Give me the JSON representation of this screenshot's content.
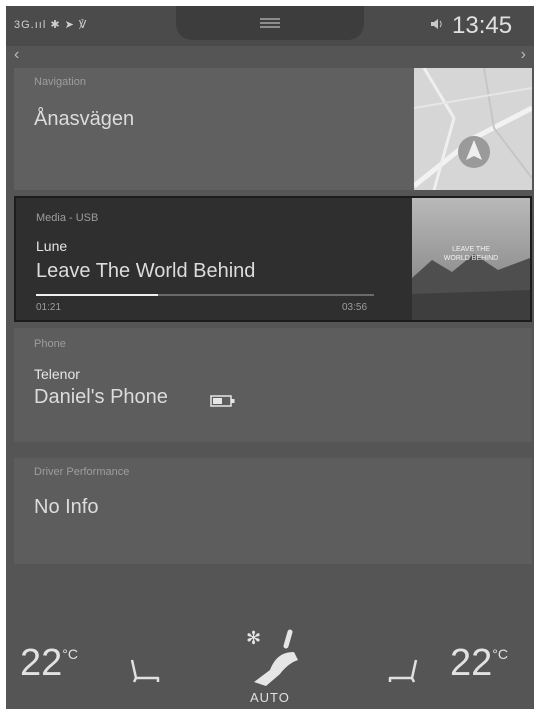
{
  "status_bar": {
    "indicators": "3G.ııl ✱ ➤ ℣",
    "volume_icon": "speaker-icon",
    "time": "13:45"
  },
  "pager": {
    "pages": 3,
    "active": 2
  },
  "navigation": {
    "label": "Navigation",
    "destination": "Ånasvägen"
  },
  "media": {
    "label": "Media - USB",
    "artist": "Lune",
    "track": "Leave The World Behind",
    "elapsed": "01:21",
    "duration": "03:56",
    "progress_fraction": 0.36,
    "album_text_line1": "LEAVE THE",
    "album_text_line2": "WORLD BEHIND"
  },
  "phone": {
    "label": "Phone",
    "carrier": "Telenor",
    "device": "Daniel's Phone"
  },
  "driver_performance": {
    "label": "Driver Performance",
    "value": "No Info"
  },
  "climate": {
    "left_temp": "22",
    "right_temp": "22",
    "unit": "°C",
    "fan_mode": "AUTO"
  }
}
